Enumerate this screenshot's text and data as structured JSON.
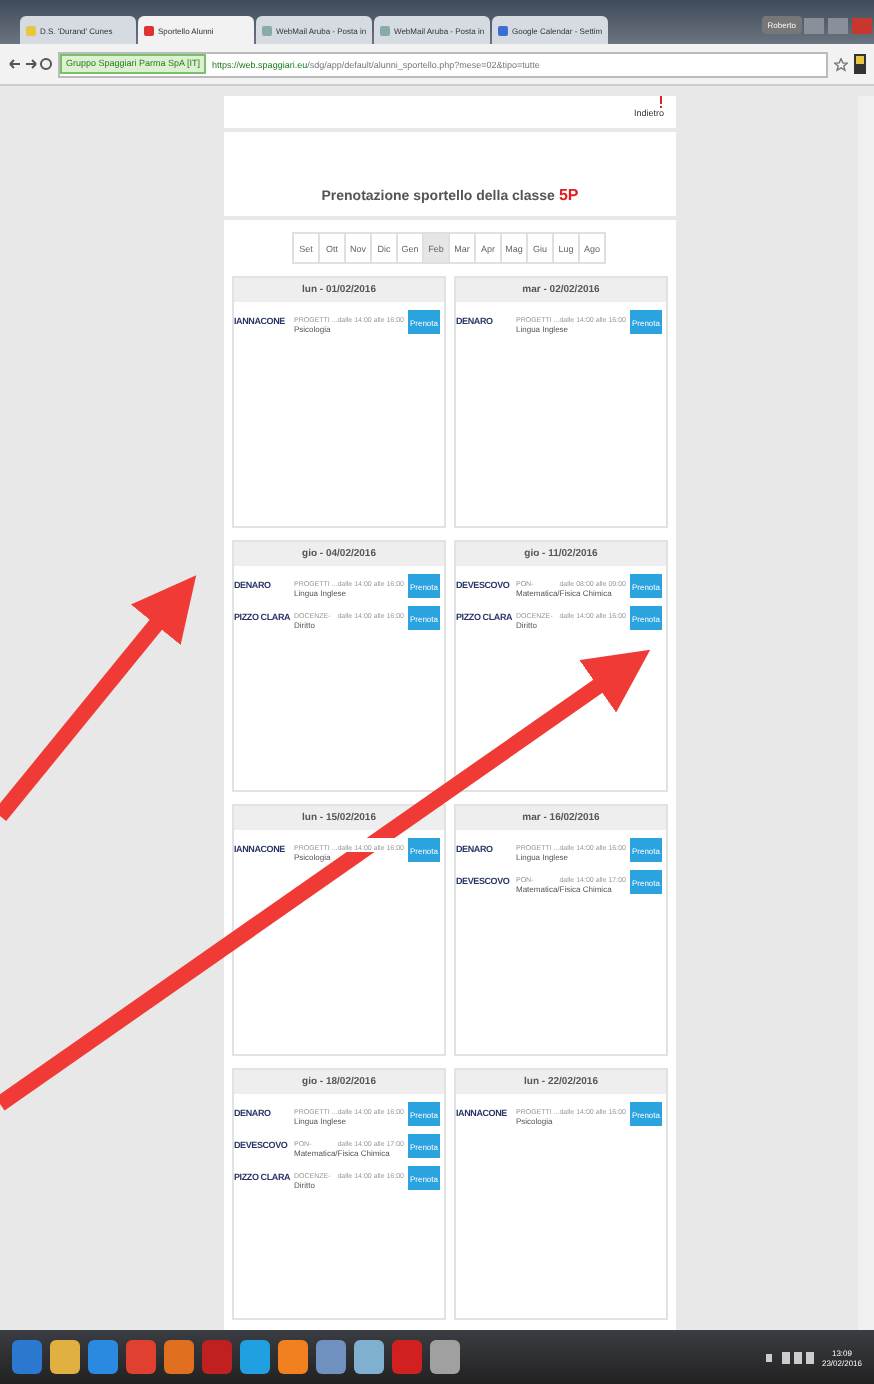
{
  "browser": {
    "tabs": [
      {
        "title": "D.S. 'Durand' Cunes",
        "selected": false
      },
      {
        "title": "Sportello Alunni",
        "selected": true
      },
      {
        "title": "WebMail Aruba - Posta in",
        "selected": false
      },
      {
        "title": "WebMail Aruba - Posta in",
        "selected": false
      },
      {
        "title": "Google Calendar - Settim",
        "selected": false
      }
    ],
    "profile": "Roberto",
    "security_label": "Gruppo Spaggiari Parma SpA [IT]",
    "url_host": "https://web.spaggiari.eu",
    "url_path": "/sdg/app/default/alunni_sportello.php?mese=02&tipo=tutte"
  },
  "page": {
    "back_label": "Indietro",
    "title": "Prenotazione sportello della classe",
    "class_name": "5P"
  },
  "months": [
    {
      "label": "Set",
      "selected": false
    },
    {
      "label": "Ott",
      "selected": false
    },
    {
      "label": "Nov",
      "selected": false
    },
    {
      "label": "Dic",
      "selected": false
    },
    {
      "label": "Gen",
      "selected": false
    },
    {
      "label": "Feb",
      "selected": true
    },
    {
      "label": "Mar",
      "selected": false
    },
    {
      "label": "Apr",
      "selected": false
    },
    {
      "label": "Mag",
      "selected": false
    },
    {
      "label": "Giu",
      "selected": false
    },
    {
      "label": "Lug",
      "selected": false
    },
    {
      "label": "Ago",
      "selected": false
    }
  ],
  "days": [
    {
      "date": "lun - 01/02/2016",
      "slots": [
        {
          "teacher": "IANNACONE",
          "type": "PROGETTI ...",
          "time": "dalle 14:00 alle 16:00",
          "subject": "Psicologia",
          "button": "Prenota"
        }
      ]
    },
    {
      "date": "mar - 02/02/2016",
      "slots": [
        {
          "teacher": "DENARO",
          "type": "PROGETTI ...",
          "time": "dalle 14:00 alle 16:00",
          "subject": "Lingua Inglese",
          "button": "Prenota"
        }
      ]
    },
    {
      "date": "gio - 04/02/2016",
      "slots": [
        {
          "teacher": "DENARO",
          "type": "PROGETTI ...",
          "time": "dalle 14:00 alle 16:00",
          "subject": "Lingua Inglese",
          "button": "Prenota"
        },
        {
          "teacher": "PIZZO CLARA",
          "type": "DOCENZE-",
          "time": "dalle 14:00 alle 16:00",
          "subject": "Diritto",
          "button": "Prenota"
        }
      ]
    },
    {
      "date": "gio - 11/02/2016",
      "slots": [
        {
          "teacher": "DEVESCOVO",
          "type": "PON-",
          "time": "dalle 08:00 alle 09:00",
          "subject": "Matematica/Fisica Chimica",
          "button": "Prenota"
        },
        {
          "teacher": "PIZZO CLARA",
          "type": "DOCENZE-",
          "time": "dalle 14:00 alle 16:00",
          "subject": "Diritto",
          "button": "Prenota"
        }
      ]
    },
    {
      "date": "lun - 15/02/2016",
      "slots": [
        {
          "teacher": "IANNACONE",
          "type": "PROGETTI ...",
          "time": "dalle 14:00 alle 16:00",
          "subject": "Psicologia",
          "button": "Prenota"
        }
      ]
    },
    {
      "date": "mar - 16/02/2016",
      "slots": [
        {
          "teacher": "DENARO",
          "type": "PROGETTI ...",
          "time": "dalle 14:00 alle 16:00",
          "subject": "Lingua Inglese",
          "button": "Prenota"
        },
        {
          "teacher": "DEVESCOVO",
          "type": "PON-",
          "time": "dalle 14:00 alle 17:00",
          "subject": "Matematica/Fisica Chimica",
          "button": "Prenota"
        }
      ]
    },
    {
      "date": "gio - 18/02/2016",
      "slots": [
        {
          "teacher": "DENARO",
          "type": "PROGETTI ...",
          "time": "dalle 14:00 alle 16:00",
          "subject": "Lingua Inglese",
          "button": "Prenota"
        },
        {
          "teacher": "DEVESCOVO",
          "type": "PON-",
          "time": "dalle 14:00 alle 17:00",
          "subject": "Matematica/Fisica Chimica",
          "button": "Prenota"
        },
        {
          "teacher": "PIZZO CLARA",
          "type": "DOCENZE-",
          "time": "dalle 14:00 alle 16:00",
          "subject": "Diritto",
          "button": "Prenota"
        }
      ]
    },
    {
      "date": "lun - 22/02/2016",
      "slots": [
        {
          "teacher": "IANNACONE",
          "type": "PROGETTI ...",
          "time": "dalle 14:00 alle 16:00",
          "subject": "Psicologia",
          "button": "Prenota"
        }
      ]
    }
  ],
  "taskbar": {
    "time": "13:09",
    "date": "23/02/2016"
  }
}
